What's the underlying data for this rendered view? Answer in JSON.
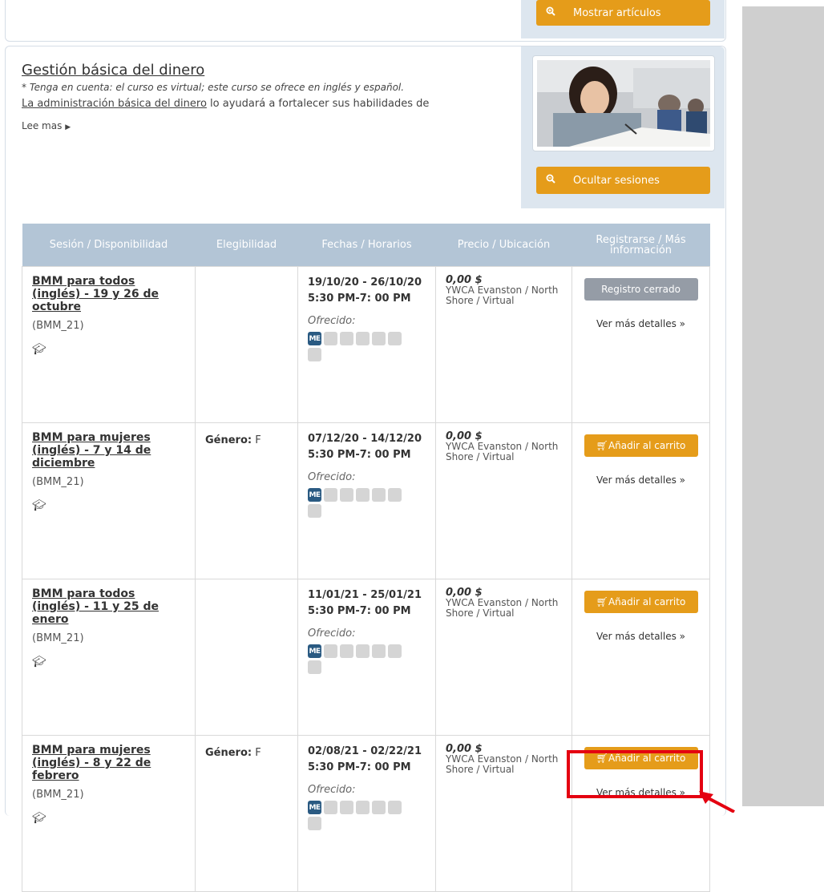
{
  "top_button": {
    "icon": "zoom-in-icon",
    "label": "Mostrar artículos"
  },
  "course": {
    "title": "Gestión básica del dinero",
    "note": "* Tenga en cuenta: el curso es virtual; este curso se ofrece en inglés y español.",
    "desc_link": "La administración básica del dinero",
    "desc_rest": " lo ayudará a fortalecer sus habilidades de",
    "read_more": "Lee mas",
    "hide_sessions": "Ocultar sesiones"
  },
  "table": {
    "headers": [
      "Sesión / Disponibilidad",
      "Elegibilidad",
      "Fechas / Horarios",
      "Precio / Ubicación",
      "Registrarse / Más información"
    ],
    "rows": [
      {
        "title": "BMM para todos (inglés) - 19 y 26 de octubre",
        "code": "(BMM_21)",
        "eligibility_label": "",
        "eligibility_value": "",
        "dates": "19/10/20 - 26/10/20",
        "time": "5:30 PM-7: 00 PM",
        "offered": "Ofrecido:",
        "day_tag": "ME",
        "price": "0,00 $",
        "location": "YWCA Evanston / North Shore / Virtual",
        "button": "Registro cerrado",
        "button_state": "closed",
        "details": "Ver más detalles »"
      },
      {
        "title": "BMM para mujeres (inglés) - 7 y 14 de diciembre",
        "code": "(BMM_21)",
        "eligibility_label": "Género:",
        "eligibility_value": " F",
        "dates": "07/12/20 - 14/12/20",
        "time": "5:30 PM-7: 00 PM",
        "offered": "Ofrecido:",
        "day_tag": "ME",
        "price": "0,00 $",
        "location": "YWCA Evanston / North Shore / Virtual",
        "button": "Añadir al carrito",
        "button_state": "add",
        "details": "Ver más detalles »"
      },
      {
        "title": "BMM para todos (inglés) - 11 y 25 de enero",
        "code": "(BMM_21)",
        "eligibility_label": "",
        "eligibility_value": "",
        "dates": "11/01/21 - 25/01/21",
        "time": "5:30 PM-7: 00 PM",
        "offered": "Ofrecido:",
        "day_tag": "ME",
        "price": "0,00 $",
        "location": "YWCA Evanston / North Shore / Virtual",
        "button": "Añadir al carrito",
        "button_state": "add",
        "details": "Ver más detalles »"
      },
      {
        "title": "BMM para mujeres (inglés) - 8 y 22 de febrero",
        "code": "(BMM_21)",
        "eligibility_label": "Género:",
        "eligibility_value": " F",
        "dates": "02/08/21 - 02/22/21",
        "time": "5:30 PM-7: 00 PM",
        "offered": "Ofrecido:",
        "day_tag": "ME",
        "price": "0,00 $",
        "location": "YWCA Evanston / North Shore / Virtual",
        "button": "Añadir al carrito",
        "button_state": "add",
        "details": "Ver más detalles »"
      }
    ]
  },
  "colors": {
    "accent": "#e59c1a",
    "header_bg": "#b3c5d6",
    "closed_btn": "#959ca6",
    "day_on": "#2a5a82",
    "annotation": "#e40010"
  }
}
